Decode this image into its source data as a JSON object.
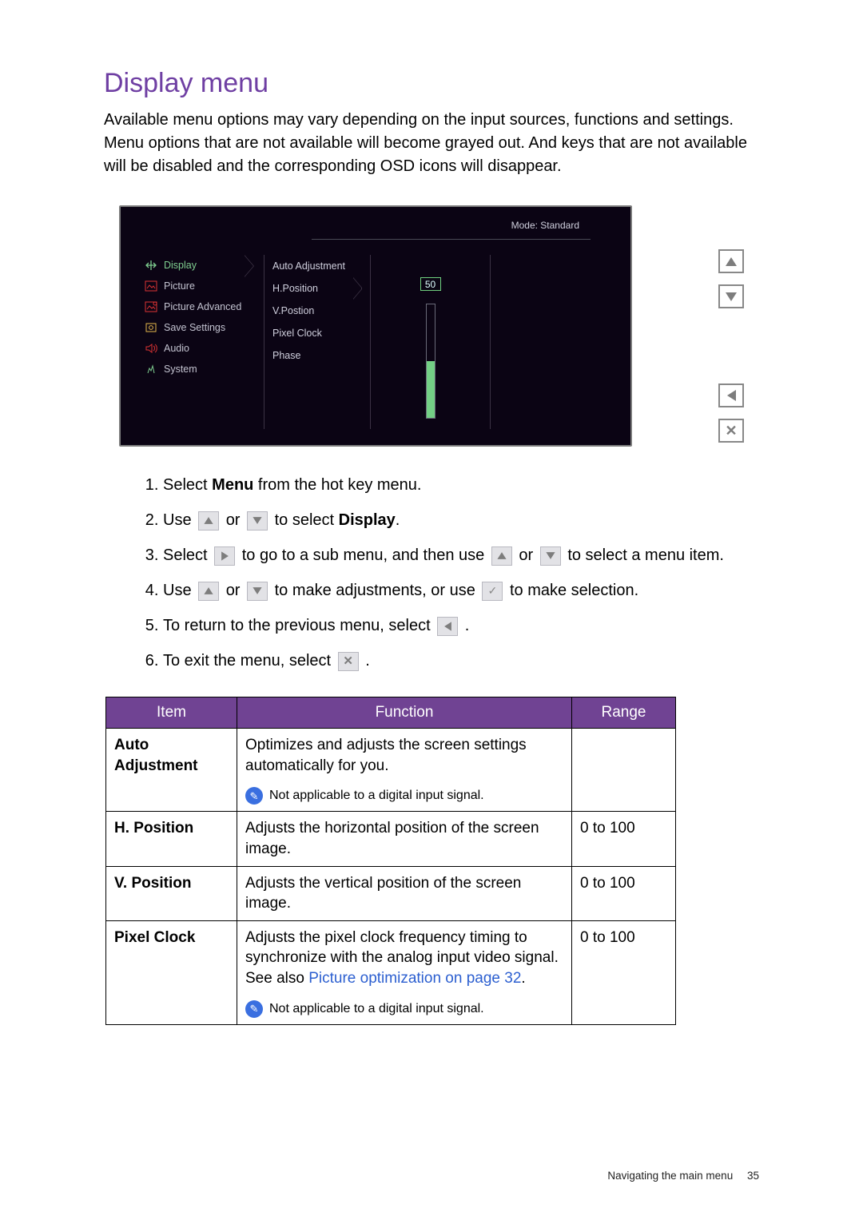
{
  "title": "Display menu",
  "intro": "Available menu options may vary depending on the input sources, functions and settings. Menu options that are not available will become grayed out. And keys that are not available will be disabled and the corresponding OSD icons will disappear.",
  "osd": {
    "mode_label": "Mode: Standard",
    "left_items": [
      {
        "label": "Display",
        "icon": "display"
      },
      {
        "label": "Picture",
        "icon": "picture"
      },
      {
        "label": "Picture Advanced",
        "icon": "picture-advanced"
      },
      {
        "label": "Save Settings",
        "icon": "save"
      },
      {
        "label": "Audio",
        "icon": "audio"
      },
      {
        "label": "System",
        "icon": "system"
      }
    ],
    "sub_items": [
      "Auto Adjustment",
      "H.Position",
      "V.Postion",
      "Pixel Clock",
      "Phase"
    ],
    "value": "50"
  },
  "steps": {
    "s1a": "Select ",
    "s1b": "Menu",
    "s1c": " from the hot key menu.",
    "s2a": "Use ",
    "s2b": " or ",
    "s2c": " to select ",
    "s2d": "Display",
    "s2e": ".",
    "s3a": "Select ",
    "s3b": " to go to a sub menu, and then use ",
    "s3c": " or ",
    "s3d": " to select a menu item.",
    "s4a": "Use ",
    "s4b": " or ",
    "s4c": " to make adjustments, or use ",
    "s4d": " to make selection.",
    "s5a": "To return to the previous menu, select ",
    "s5b": " .",
    "s6a": "To exit the menu, select ",
    "s6b": " ."
  },
  "table": {
    "headers": {
      "item": "Item",
      "function": "Function",
      "range": "Range"
    },
    "rows": [
      {
        "item": "Auto Adjustment",
        "func": "Optimizes and adjusts the screen settings automatically for you.",
        "note": "Not applicable to a digital input signal.",
        "range": ""
      },
      {
        "item": "H. Position",
        "func": "Adjusts the horizontal position of the screen image.",
        "range": "0 to 100"
      },
      {
        "item": "V. Position",
        "func": "Adjusts the vertical position of the screen image.",
        "range": "0 to 100"
      },
      {
        "item": "Pixel Clock",
        "func": "Adjusts the pixel clock frequency timing to synchronize with the analog input video signal. See also ",
        "xref": "Picture optimization on page 32",
        "func_tail": ".",
        "note": "Not applicable to a digital input signal.",
        "range": "0 to 100"
      }
    ]
  },
  "footer": {
    "text": "Navigating the main menu",
    "page": "35"
  }
}
